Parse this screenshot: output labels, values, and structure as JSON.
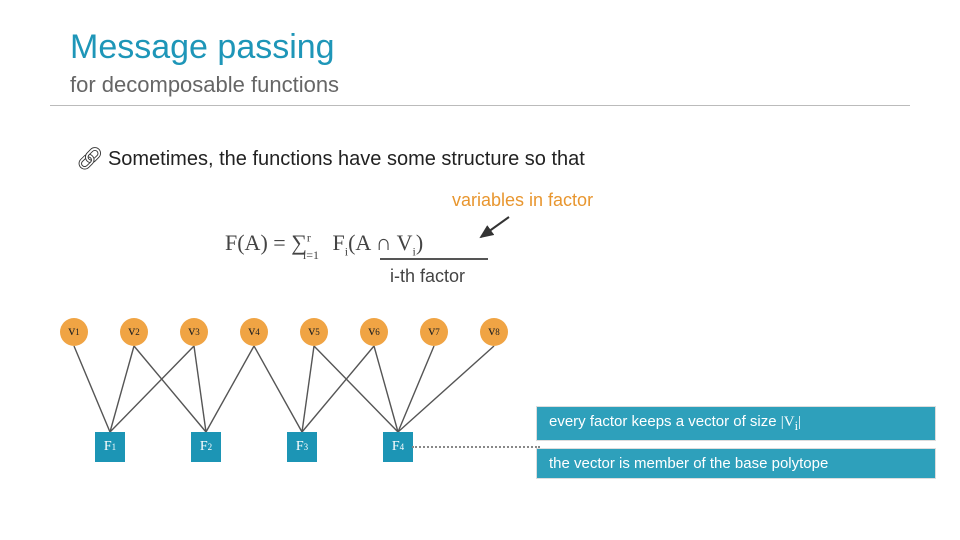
{
  "header": {
    "title": "Message passing",
    "subtitle": "for decomposable functions"
  },
  "bullet": {
    "text": "Sometimes, the functions have some structure so that"
  },
  "formula": {
    "lhs": "F(A) = ",
    "sum_pre": "∑",
    "sum_upper": "r",
    "sum_lower": "i=1",
    "term": " F",
    "term_sub": "i",
    "term_arg": "(A ∩ V",
    "term_arg_sub": "i",
    "term_close": ")",
    "ith_label": "i-th factor",
    "vars_label": "variables in factor"
  },
  "nodes": [
    {
      "label": "v",
      "sub": "1"
    },
    {
      "label": "v",
      "sub": "2"
    },
    {
      "label": "v",
      "sub": "3"
    },
    {
      "label": "v",
      "sub": "4"
    },
    {
      "label": "v",
      "sub": "5"
    },
    {
      "label": "v",
      "sub": "6"
    },
    {
      "label": "v",
      "sub": "7"
    },
    {
      "label": "v",
      "sub": "8"
    }
  ],
  "factors": [
    {
      "label": "F",
      "sub": "1"
    },
    {
      "label": "F",
      "sub": "2"
    },
    {
      "label": "F",
      "sub": "3"
    },
    {
      "label": "F",
      "sub": "4"
    }
  ],
  "info": {
    "line1_pre": "every factor keeps a vector of size ",
    "line1_vi": "|V",
    "line1_vi_sub": "i",
    "line1_vi_close": "|",
    "line2": "the vector is member of the base polytope"
  },
  "edges": [
    [
      74,
      346,
      110,
      432
    ],
    [
      134,
      346,
      110,
      432
    ],
    [
      194,
      346,
      110,
      432
    ],
    [
      134,
      346,
      206,
      432
    ],
    [
      194,
      346,
      206,
      432
    ],
    [
      254,
      346,
      206,
      432
    ],
    [
      254,
      346,
      302,
      432
    ],
    [
      314,
      346,
      302,
      432
    ],
    [
      374,
      346,
      302,
      432
    ],
    [
      314,
      346,
      398,
      432
    ],
    [
      374,
      346,
      398,
      432
    ],
    [
      434,
      346,
      398,
      432
    ],
    [
      494,
      346,
      398,
      432
    ]
  ]
}
